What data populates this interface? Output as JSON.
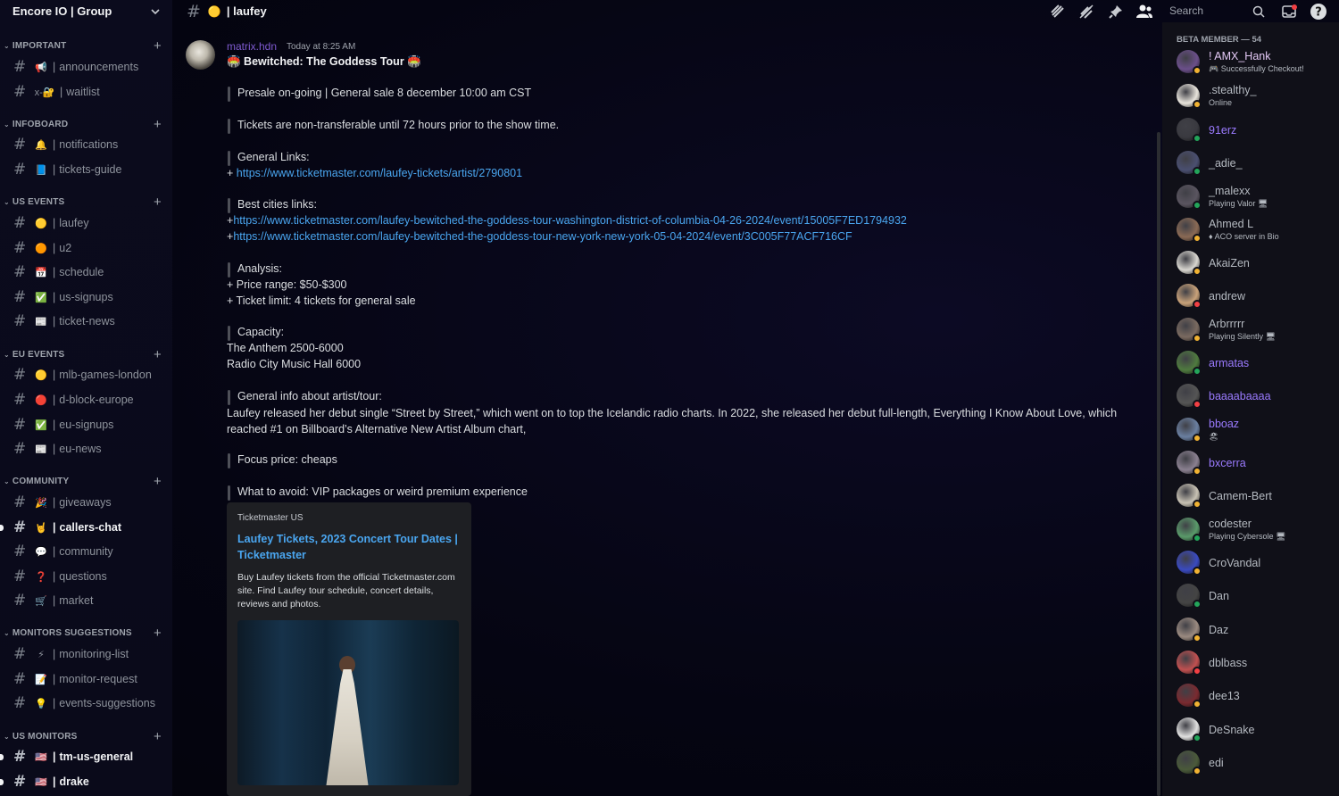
{
  "server": {
    "name": "Encore IO | Group"
  },
  "sidebar": {
    "categories": [
      {
        "label": "IMPORTANT"
      },
      {
        "label": "INFOBOARD"
      },
      {
        "label": "US EVENTS"
      },
      {
        "label": "EU EVENTS"
      },
      {
        "label": "COMMUNITY"
      },
      {
        "label": "MONITORS SUGGESTIONS"
      },
      {
        "label": "US MONITORS"
      }
    ],
    "channels": [
      {
        "emoji": "📢",
        "name": "announcements"
      },
      {
        "emoji": "x-🔐",
        "name": "waitlist"
      },
      {
        "emoji": "🔔",
        "name": "notifications"
      },
      {
        "emoji": "📘",
        "name": "tickets-guide"
      },
      {
        "emoji": "🟡",
        "name": "laufey"
      },
      {
        "emoji": "🟠",
        "name": "u2"
      },
      {
        "emoji": "📅",
        "name": "schedule"
      },
      {
        "emoji": "✅",
        "name": "us-signups"
      },
      {
        "emoji": "📰",
        "name": "ticket-news"
      },
      {
        "emoji": "🟡",
        "name": "mlb-games-london"
      },
      {
        "emoji": "🔴",
        "name": "d-block-europe"
      },
      {
        "emoji": "✅",
        "name": "eu-signups"
      },
      {
        "emoji": "📰",
        "name": "eu-news"
      },
      {
        "emoji": "🎉",
        "name": "giveaways"
      },
      {
        "emoji": "🤘",
        "name": "callers-chat"
      },
      {
        "emoji": "💬",
        "name": "community"
      },
      {
        "emoji": "❓",
        "name": "questions"
      },
      {
        "emoji": "🛒",
        "name": "market"
      },
      {
        "emoji": "⚡",
        "name": "monitoring-list"
      },
      {
        "emoji": "📝",
        "name": "monitor-request"
      },
      {
        "emoji": "💡",
        "name": "events-suggestions"
      },
      {
        "emoji": "🇺🇸",
        "name": "tm-us-general"
      },
      {
        "emoji": "🇺🇸",
        "name": "drake"
      }
    ]
  },
  "topbar": {
    "channel_emoji": "🟡",
    "channel_name": "| laufey",
    "search_placeholder": "Search",
    "icons": [
      "threads-icon",
      "mute-icon",
      "pin-icon",
      "members-icon",
      "search-icon",
      "inbox-icon",
      "help-icon"
    ]
  },
  "message": {
    "author": "matrix.hdn",
    "timestamp": "Today at 8:25 AM",
    "title": "🏟️ Bewitched: The Goddess Tour 🏟️",
    "lines": [
      "Presale on-going  | General sale 8 december 10:00 am CST",
      "Tickets are non-transferable until 72 hours prior to the show time.",
      "General Links:",
      "https://www.ticketmaster.com/laufey-tickets/artist/2790801",
      "Best cities links:",
      "https://www.ticketmaster.com/laufey-bewitched-the-goddess-tour-washington-district-of-columbia-04-26-2024/event/15005F7ED1794932",
      "https://www.ticketmaster.com/laufey-bewitched-the-goddess-tour-new-york-new-york-05-04-2024/event/3C005F77ACF716CF",
      "Analysis:",
      "+ Price range: $50-$300",
      "+ Ticket limit: 4 tickets for general sale",
      "Capacity:",
      "The Anthem 2500-6000",
      "Radio City Music Hall 6000",
      "General info about artist/tour:",
      "Laufey released her debut single “Street by Street,” which went on to top the Icelandic radio charts. In 2022, she released her debut full-length, Everything I Know About Love, which reached #1 on Billboard’s Alternative New Artist Album chart,",
      "Focus price: cheaps",
      "What to avoid: VIP packages or weird premium experience"
    ],
    "plus": "+",
    "embed": {
      "provider": "Ticketmaster US",
      "title": "Laufey Tickets, 2023 Concert Tour Dates | Ticketmaster",
      "description": "Buy Laufey tickets from the official Ticketmaster.com site. Find Laufey tour schedule, concert details, reviews and photos."
    }
  },
  "members": {
    "header": "BETA MEMBER — 54",
    "list": [
      {
        "name": "! AMX_Hank",
        "sub": "🎮 Successfully Checkout!",
        "color": "#e3c8f5",
        "status": "idle"
      },
      {
        "name": ".stealthy_",
        "sub": "Online",
        "color": "#b5bac1",
        "status": "idle"
      },
      {
        "name": "91erz",
        "sub": "",
        "color": "#9b7bff",
        "status": "online"
      },
      {
        "name": "_adie_",
        "sub": "",
        "color": "#b5bac1",
        "status": "online"
      },
      {
        "name": "_malexx",
        "sub": "Playing Valor 🖥",
        "color": "#b5bac1",
        "status": "online"
      },
      {
        "name": "Ahmed L",
        "sub": "♦ ACO server in Bio",
        "color": "#b5bac1",
        "status": "idle"
      },
      {
        "name": "AkaiZen",
        "sub": "",
        "color": "#b5bac1",
        "status": "idle"
      },
      {
        "name": "andrew",
        "sub": "",
        "color": "#b5bac1",
        "status": "dnd"
      },
      {
        "name": "Arbrrrrr",
        "sub": "Playing Silently 🖥",
        "color": "#b5bac1",
        "status": "idle"
      },
      {
        "name": "armatas",
        "sub": "",
        "color": "#9b7bff",
        "status": "online"
      },
      {
        "name": "baaaabaaaa",
        "sub": "",
        "color": "#9b7bff",
        "status": "dnd"
      },
      {
        "name": "bboaz",
        "sub": "🏖",
        "color": "#9b7bff",
        "status": "idle"
      },
      {
        "name": "bxcerra",
        "sub": "",
        "color": "#9b7bff",
        "status": "idle"
      },
      {
        "name": "Camem-Bert",
        "sub": "",
        "color": "#b5bac1",
        "status": "idle"
      },
      {
        "name": "codester",
        "sub": "Playing Cybersole 🖥",
        "color": "#b5bac1",
        "status": "online"
      },
      {
        "name": "CroVandal",
        "sub": "",
        "color": "#b5bac1",
        "status": "idle"
      },
      {
        "name": "Dan",
        "sub": "",
        "color": "#b5bac1",
        "status": "online"
      },
      {
        "name": "Daz",
        "sub": "",
        "color": "#b5bac1",
        "status": "idle"
      },
      {
        "name": "dblbass",
        "sub": "",
        "color": "#b5bac1",
        "status": "dnd"
      },
      {
        "name": "dee13",
        "sub": "",
        "color": "#b5bac1",
        "status": "idle"
      },
      {
        "name": "DeSnake",
        "sub": "",
        "color": "#b5bac1",
        "status": "mobile"
      },
      {
        "name": "edi",
        "sub": "",
        "color": "#b5bac1",
        "status": "idle"
      }
    ]
  },
  "colors": {
    "link": "#4aa6f0",
    "author": "#7f5bd1",
    "online": "#23a55a",
    "idle": "#f0b232",
    "dnd": "#f23f43"
  }
}
